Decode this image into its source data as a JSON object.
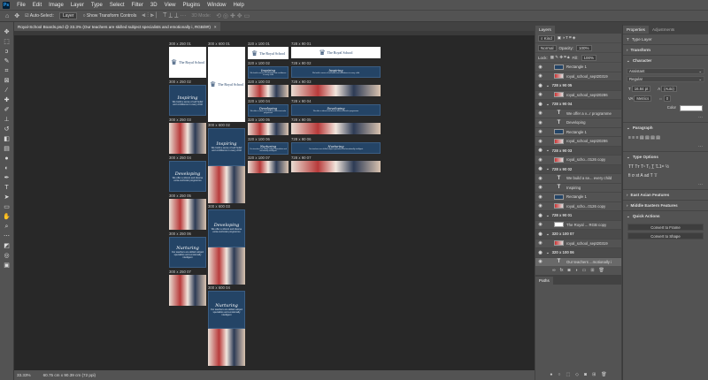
{
  "menu": [
    "File",
    "Edit",
    "Image",
    "Layer",
    "Type",
    "Select",
    "Filter",
    "3D",
    "View",
    "Plugins",
    "Window",
    "Help"
  ],
  "app_logo": "Ps",
  "options": {
    "auto_select": "Auto-Select:",
    "layer_select": "Layer",
    "transform_controls": "Show Transform Controls",
    "mode_3d": "3D Mode:"
  },
  "document_tab": "Royal-School Boards.psd @ 33.3% (Our teachers are skilled subject  specialists and emotionally i, RGB/8#)",
  "status": {
    "zoom": "33.33%",
    "doc_size": "60.75 cm x 90.39 cm (72 ppi)"
  },
  "brand": {
    "name": "The Royal School",
    "navy": "#244466"
  },
  "columns": [
    {
      "key": "c1",
      "artboards": [
        {
          "label": "300 x 250 01",
          "type": "logo"
        },
        {
          "label": "300 x 250 02",
          "type": "text",
          "h": "Inspiring",
          "b": "We build a sense of self belief and confidence in every child"
        },
        {
          "label": "300 x 250 03",
          "type": "photo"
        },
        {
          "label": "300 x 250 04",
          "type": "text",
          "h": "Developing",
          "b": "We offer a vibrant and diverse extra-curricular programme"
        },
        {
          "label": "300 x 250 05",
          "type": "photo"
        },
        {
          "label": "300 x 250 06",
          "type": "text",
          "h": "Nurturing",
          "b": "Our teachers are skilled subject specialists and emotionally intelligent"
        },
        {
          "label": "300 x 250 07",
          "type": "photo"
        }
      ]
    },
    {
      "key": "c2",
      "artboards": [
        {
          "label": "300 x 600 01",
          "type": "logo"
        },
        {
          "label": "300 x 600 02",
          "type": "textphoto",
          "h": "Inspiring",
          "b": "We build a sense of self belief and confidence in every child"
        },
        {
          "label": "300 x 600 03",
          "type": "textphoto",
          "h": "Developing",
          "b": "We offer a vibrant and diverse extra-curricular programme"
        },
        {
          "label": "300 x 600 04",
          "type": "textphoto",
          "h": "Nurturing",
          "b": "Our teachers are skilled subject specialists and emotionally intelligent"
        }
      ]
    },
    {
      "key": "c3",
      "artboards": [
        {
          "label": "320 x 100 01",
          "type": "logo"
        },
        {
          "label": "320 x 100 02",
          "type": "text",
          "h": "Inspiring",
          "b": "We build a sense of self belief and confidence in every child"
        },
        {
          "label": "320 x 100 03",
          "type": "photo"
        },
        {
          "label": "320 x 100 04",
          "type": "text",
          "h": "Developing",
          "b": "We offer a vibrant and diverse extra-curricular programme"
        },
        {
          "label": "320 x 100 05",
          "type": "photo"
        },
        {
          "label": "320 x 100 06",
          "type": "text",
          "h": "Nurturing",
          "b": "Our teachers are skilled subject specialists and emotionally intelligent"
        },
        {
          "label": "320 x 100 07",
          "type": "photo"
        }
      ]
    },
    {
      "key": "c4",
      "artboards": [
        {
          "label": "728 x 90 01",
          "type": "logo"
        },
        {
          "label": "728 x 90 02",
          "type": "text",
          "h": "Inspiring",
          "b": "We build a sense of self belief and confidence in every child"
        },
        {
          "label": "728 x 90 03",
          "type": "photo"
        },
        {
          "label": "728 x 90 04",
          "type": "text",
          "h": "Developing",
          "b": "We offer a vibrant and diverse extra-curricular programme"
        },
        {
          "label": "728 x 90 05",
          "type": "photo"
        },
        {
          "label": "728 x 90 06",
          "type": "text",
          "h": "Nurturing",
          "b": "Our teachers are skilled subject specialists and emotionally intelligent"
        },
        {
          "label": "728 x 90 07",
          "type": "photo"
        }
      ]
    }
  ],
  "layers_panel": {
    "tabs": [
      "Layers"
    ],
    "filter": "Kind",
    "blend": "Normal",
    "opacity_label": "Opacity:",
    "opacity": "100%",
    "lock_label": "Lock:",
    "fill_label": "Fill:",
    "fill": "100%",
    "rows": [
      {
        "kind": "rect",
        "name": "Rectangle 1"
      },
      {
        "kind": "photo",
        "name": "royal_school_sept20319"
      },
      {
        "kind": "group",
        "name": "728 x 90 05"
      },
      {
        "kind": "photo",
        "name": "royal_school_sept20286"
      },
      {
        "kind": "group",
        "name": "728 x 90 04"
      },
      {
        "kind": "text",
        "name": "We offer a v...r programme"
      },
      {
        "kind": "text",
        "name": "Developing"
      },
      {
        "kind": "rect",
        "name": "Rectangle 1"
      },
      {
        "kind": "photo",
        "name": "royal_school_sept20286"
      },
      {
        "kind": "group",
        "name": "728 x 90 03"
      },
      {
        "kind": "photo",
        "name": "royal_scho...0126 copy"
      },
      {
        "kind": "group",
        "name": "728 x 90 02"
      },
      {
        "kind": "text",
        "name": "We build a se... every child"
      },
      {
        "kind": "text",
        "name": "Inspiring"
      },
      {
        "kind": "rect",
        "name": "Rectangle 1"
      },
      {
        "kind": "photo",
        "name": "royal_scho...0126 copy"
      },
      {
        "kind": "group",
        "name": "728 x 90 01"
      },
      {
        "kind": "logo",
        "name": "The Royal ... RGB copy"
      },
      {
        "kind": "group",
        "name": "320 x 100 07"
      },
      {
        "kind": "photo",
        "name": "royal_school_sept20319"
      },
      {
        "kind": "group",
        "name": "320 x 100 06"
      },
      {
        "kind": "textsel",
        "name": "Our teachers ...motionally i"
      }
    ]
  },
  "paths_panel": {
    "title": "Paths"
  },
  "properties": {
    "tabs": [
      "Properties",
      "Adjustments"
    ],
    "layer_type": "Type Layer",
    "transform": "Transform",
    "character": "Character",
    "font": "Assistant",
    "style": "Regular",
    "size": "16.84 pt",
    "leading": "(Auto)",
    "kerning": "Metrics",
    "tracking": "0",
    "color_label": "Color",
    "paragraph": "Paragraph",
    "type_options": "Type Options",
    "east_asian": "East Asian Features",
    "middle_eastern": "Middle Eastern Features",
    "quick_actions": "Quick Actions",
    "convert_frame": "Convert to Frame",
    "convert_shape": "Convert to Shape"
  }
}
